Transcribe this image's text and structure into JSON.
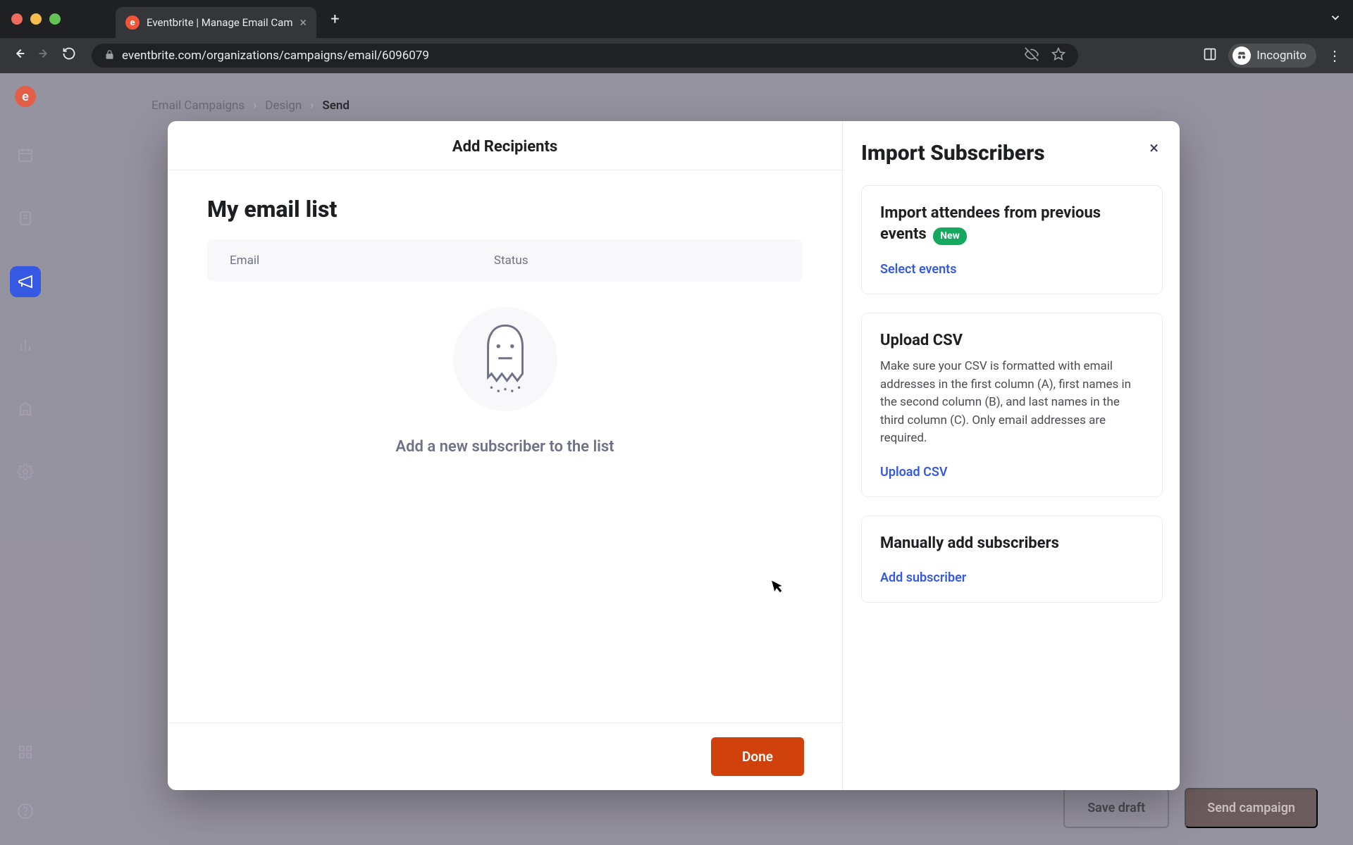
{
  "browser": {
    "tab_title": "Eventbrite | Manage Email Cam",
    "url": "eventbrite.com/organizations/campaigns/email/6096079",
    "incognito_label": "Incognito"
  },
  "breadcrumbs": {
    "item0": "Email Campaigns",
    "item1": "Design",
    "item2": "Send"
  },
  "page_actions": {
    "save_draft": "Save draft",
    "send_campaign": "Send campaign"
  },
  "modal": {
    "header": "Add Recipients",
    "list_title": "My email list",
    "table": {
      "col_email": "Email",
      "col_status": "Status"
    },
    "empty_text": "Add a new subscriber to the list",
    "done_label": "Done"
  },
  "sidebar": {
    "title": "Import Subscribers",
    "card_import": {
      "title": "Import attendees from previous events",
      "badge": "New",
      "action": "Select events"
    },
    "card_csv": {
      "title": "Upload CSV",
      "desc": "Make sure your CSV is formatted with email addresses in the first column (A), first names in the second column (B), and last names in the third column (C). Only email addresses are required.",
      "action": "Upload CSV"
    },
    "card_manual": {
      "title": "Manually add subscribers",
      "action": "Add subscriber"
    }
  }
}
